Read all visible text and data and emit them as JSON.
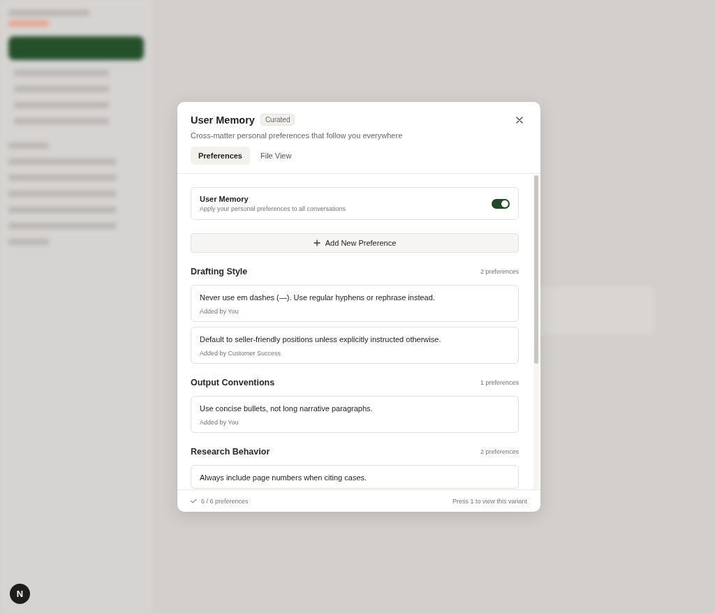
{
  "dialog": {
    "title": "User Memory",
    "badge": "Curated",
    "subtitle": "Cross-matter personal preferences that follow you everywhere",
    "tabs": [
      {
        "label": "Preferences",
        "selected": true
      },
      {
        "label": "File View",
        "selected": false
      }
    ],
    "memory_toggle": {
      "title": "User Memory",
      "description": "Apply your personal preferences to all conversations",
      "on": true
    },
    "add_button": "Add New Preference",
    "sections": [
      {
        "title": "Drafting Style",
        "count": "2 preferences",
        "items": [
          {
            "text": "Never use em dashes (—). Use regular hyphens or rephrase instead.",
            "author": "Added by You"
          },
          {
            "text": "Default to seller-friendly positions unless explicitly instructed otherwise.",
            "author": "Added by Customer Success"
          }
        ]
      },
      {
        "title": "Output Conventions",
        "count": "1 preferences",
        "items": [
          {
            "text": "Use concise bullets, not long narrative paragraphs.",
            "author": "Added by You"
          }
        ]
      },
      {
        "title": "Research Behavior",
        "count": "2 preferences",
        "items": [
          {
            "text": "Always include page numbers when citing cases."
          }
        ]
      }
    ],
    "footer": {
      "status": "6 / 6 preferences",
      "hint": "Press 1 to view this variant"
    }
  },
  "dev_badge": "N"
}
